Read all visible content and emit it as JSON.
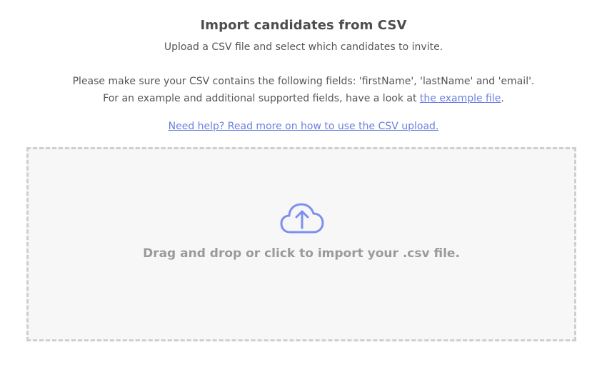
{
  "header": {
    "title": "Import candidates from CSV",
    "subtitle": "Upload a CSV file and select which candidates to invite."
  },
  "instructions": {
    "fields_text": "Please make sure your CSV contains the following fields: 'firstName', 'lastName' and 'email'.",
    "example_prefix": "For an example and additional supported fields, have a look at ",
    "example_link": "the example file",
    "example_suffix": "."
  },
  "help": {
    "link_text": "Need help? Read more on how to use the CSV upload."
  },
  "dropzone": {
    "icon": "cloud-upload-icon",
    "text": "Drag and drop or click to import your .csv file."
  },
  "colors": {
    "link": "#6b7fe0",
    "icon": "#7b8ff0",
    "dropzone_border": "#cfcfcf",
    "dropzone_bg": "#f7f7f7"
  }
}
